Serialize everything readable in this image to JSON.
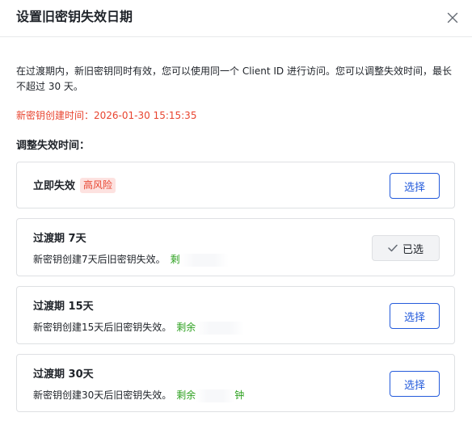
{
  "dialog": {
    "title": "设置旧密钥失效日期",
    "close_label": "X"
  },
  "description": "在过渡期内，新旧密钥同时有效，您可以使用同一个 Client ID 进行访问。您可以调整失效时间，最长不超过 30 天。",
  "created_time": "新密钥创建时间：2026-01-30 15:15:35",
  "section_label": "调整失效时间：",
  "options": [
    {
      "title": "立即失效",
      "badge": "高风险",
      "subtitle": "",
      "remaining": "",
      "button": "选择",
      "selected": false
    },
    {
      "title": "过渡期 7天",
      "badge": "",
      "subtitle": "新密钥创建7天后旧密钥失效。",
      "remaining": "剩",
      "button": "已选",
      "selected": true
    },
    {
      "title": "过渡期 15天",
      "badge": "",
      "subtitle": "新密钥创建15天后旧密钥失效。",
      "remaining": "剩余",
      "button": "选择",
      "selected": false
    },
    {
      "title": "过渡期 30天",
      "badge": "",
      "subtitle": "新密钥创建30天后旧密钥失效。",
      "remaining": "剩余",
      "remaining_tail": "钟",
      "button": "选择",
      "selected": false
    }
  ],
  "colors": {
    "primary": "#245bdb",
    "danger": "#e8442f",
    "danger_bg": "#fde2e0",
    "success": "#2ea121",
    "border": "#dee0e3"
  }
}
